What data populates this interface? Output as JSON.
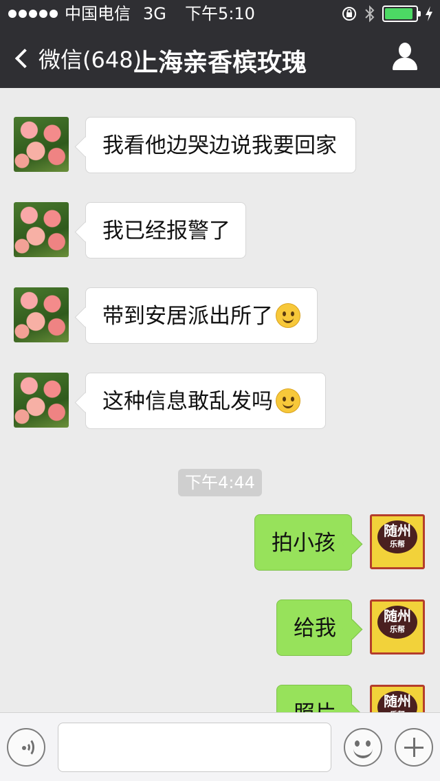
{
  "status_bar": {
    "carrier": "中国电信",
    "network": "3G",
    "time": "下午5:10",
    "signal_dots": 5,
    "icons": [
      "rotation-lock-icon",
      "bluetooth-icon",
      "battery-icon",
      "charging-icon"
    ],
    "battery_level": 0.8,
    "battery_color": "#4cd964"
  },
  "nav": {
    "back_label": "微信(648)",
    "title": "上海亲香槟玫瑰",
    "profile_icon": "person-icon"
  },
  "messages": [
    {
      "side": "left",
      "text": "我看他边哭边说我要回家",
      "emoji": false
    },
    {
      "side": "left",
      "text": "我已经报警了",
      "emoji": false
    },
    {
      "side": "left",
      "text": "带到安居派出所了",
      "emoji": true
    },
    {
      "side": "left",
      "text": "这种信息敢乱发吗",
      "emoji": true
    },
    {
      "side": "right",
      "text": "拍小孩",
      "emoji": false
    },
    {
      "side": "right",
      "text": "给我",
      "emoji": false
    },
    {
      "side": "right",
      "text": "照片",
      "emoji": false
    }
  ],
  "timestamp": "下午4:44",
  "right_avatar": {
    "title": "随州",
    "subtitle": "乐帮"
  },
  "input_bar": {
    "icons": [
      "voice-icon",
      "emoji-face-icon",
      "plus-icon"
    ],
    "text_value": ""
  },
  "colors": {
    "nav_background": "#2f2f33",
    "chat_background": "#ebebeb",
    "own_bubble": "#97e25b",
    "other_bubble": "#ffffff"
  }
}
